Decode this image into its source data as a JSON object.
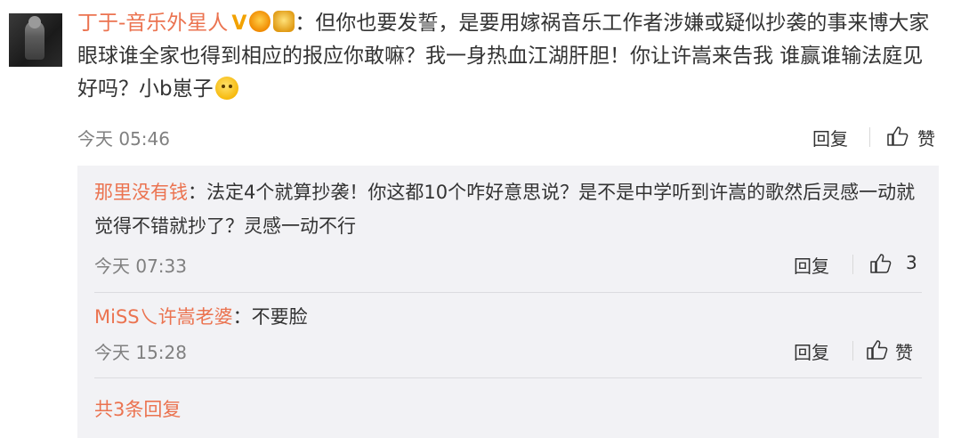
{
  "comment": {
    "username": "丁于-音乐外星人",
    "verified_mark": "V",
    "separator": "：",
    "text": "但你也要发誓，是要用嫁祸音乐工作者涉嫌或疑似抄袭的事来博大家眼球谁全家也得到相应的报应你敢嘛？我一身热血江湖肝胆！你让许嵩来告我 谁赢谁输法庭见好吗？小b崽子",
    "time": "今天 05:46",
    "reply_label": "回复",
    "like_label": "赞"
  },
  "replies": [
    {
      "username": "那里没有钱",
      "separator": "：",
      "text": "法定4个就算抄袭！你这都10个咋好意思说？是不是中学听到许嵩的歌然后灵感一动就觉得不错就抄了？灵感一动不行",
      "time": "今天 07:33",
      "reply_label": "回复",
      "like_label": "3"
    },
    {
      "username": "MiSS乀许嵩老婆",
      "separator": "：",
      "text": "不要脸",
      "time": "今天 15:28",
      "reply_label": "回复",
      "like_label": "赞"
    }
  ],
  "more_replies": "共3条回复",
  "colors": {
    "username": "#eb7350",
    "reply_box": "#f2f2f5",
    "meta": "#808080"
  }
}
